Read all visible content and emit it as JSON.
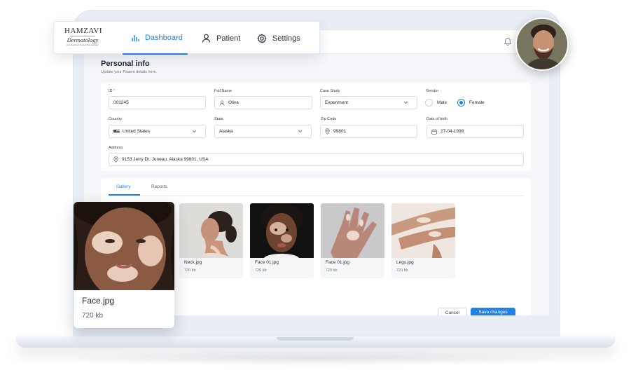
{
  "brand": {
    "logo_line1": "HAMZAVI",
    "logo_line2": "Dermatology",
    "logo_line3": "Iam Hamzavi Center Dermatology"
  },
  "nav": {
    "dashboard": "Dashboard",
    "patient": "Patient",
    "settings": "Settings"
  },
  "personal_info": {
    "title": "Personal info",
    "subtitle": "Update your Patient details here."
  },
  "form": {
    "id_label": "ID",
    "id_required": "*",
    "id_value": "001245",
    "full_name_label": "Full Name",
    "full_name_value": "Oliva",
    "case_study_label": "Case Study",
    "case_study_value": "Experiment",
    "gender_label": "Gender",
    "gender_options": [
      "Male",
      "Female"
    ],
    "gender_selected": "Female",
    "country_label": "Country",
    "country_value": "United States",
    "state_label": "State",
    "state_value": "Alaska",
    "zip_label": "Zip Code",
    "zip_value": "99801",
    "dob_label": "Date of birth",
    "dob_value": "27-04-1998",
    "address_label": "Address",
    "address_value": "9153 Jerry Dr, Juneau, Alaska 99801, USA"
  },
  "tabs": {
    "gallery": "Gallery",
    "reports": "Reports"
  },
  "gallery": [
    {
      "name": "Neck.jpg",
      "size": "720 kb"
    },
    {
      "name": "Face 01.jpg",
      "size": "720 kb"
    },
    {
      "name": "Face 01.jpg",
      "size": "720 kb"
    },
    {
      "name": "Legs.jpg",
      "size": "720 kb"
    }
  ],
  "featured": {
    "name": "Face.jpg",
    "size": "720 kb"
  },
  "actions": {
    "cancel": "Cancel",
    "save": "Save changes"
  },
  "colors": {
    "accent": "#1e82e8",
    "required": "#e5484d"
  }
}
